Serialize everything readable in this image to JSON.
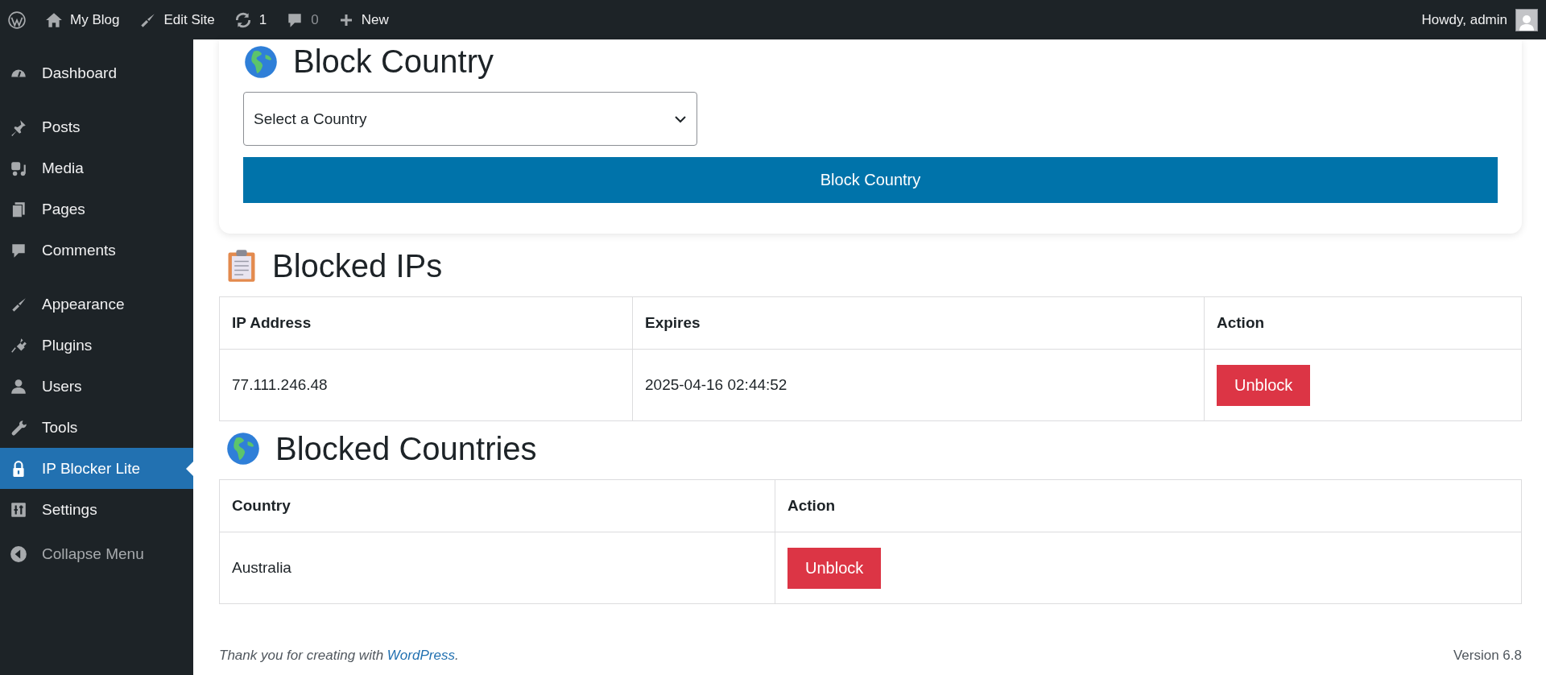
{
  "admin_bar": {
    "items": [
      {
        "kind": "logo"
      },
      {
        "kind": "home",
        "label": "My Blog"
      },
      {
        "kind": "brush",
        "label": "Edit Site"
      },
      {
        "kind": "updates",
        "label": "1"
      },
      {
        "kind": "comments",
        "label": "0"
      },
      {
        "kind": "new",
        "label": "New"
      }
    ],
    "greeting": "Howdy, admin"
  },
  "sidebar": {
    "items": [
      {
        "label": "Dashboard",
        "selected": false
      },
      {
        "label": "Posts",
        "selected": false
      },
      {
        "label": "Media",
        "selected": false
      },
      {
        "label": "Pages",
        "selected": false
      },
      {
        "label": "Comments",
        "selected": false
      },
      {
        "label": "Appearance",
        "selected": false
      },
      {
        "label": "Plugins",
        "selected": false
      },
      {
        "label": "Users",
        "selected": false
      },
      {
        "label": "Tools",
        "selected": false
      },
      {
        "label": "IP Blocker Lite",
        "selected": true
      },
      {
        "label": "Settings",
        "selected": false
      }
    ],
    "collapse": "Collapse Menu"
  },
  "block_country": {
    "title": "Block Country",
    "select_placeholder": "Select a Country",
    "button": "Block Country"
  },
  "blocked_ips": {
    "title": "Blocked IPs",
    "columns": [
      "IP Address",
      "Expires",
      "Action"
    ],
    "rows": [
      {
        "ip": "77.111.246.48",
        "expires": "2025-04-16 02:44:52",
        "action": "Unblock"
      }
    ]
  },
  "blocked_countries": {
    "title": "Blocked Countries",
    "columns": [
      "Country",
      "Action"
    ],
    "rows": [
      {
        "country": "Australia",
        "action": "Unblock"
      }
    ]
  },
  "footer": {
    "text_before": "Thank you for creating with ",
    "link": "WordPress",
    "text_after": ".",
    "version": "Version 6.8"
  }
}
